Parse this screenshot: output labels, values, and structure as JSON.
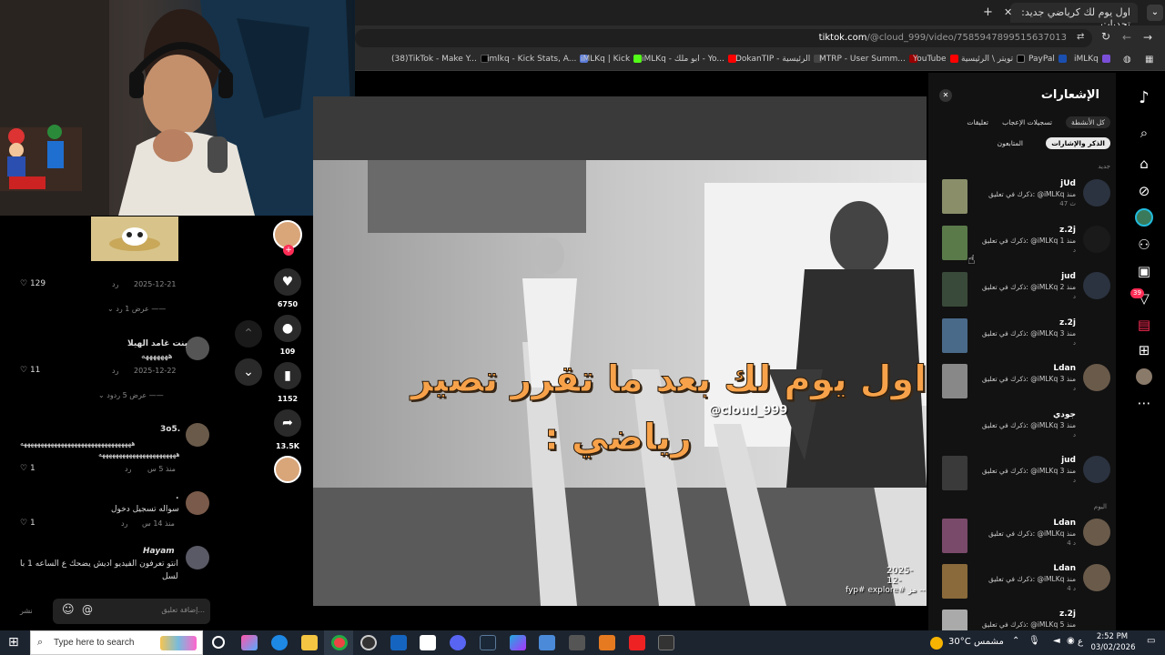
{
  "browser": {
    "tab_title": "اول يوم لك كرياضي جديد: تحديات",
    "url_domain": "tiktok.com",
    "url_path": "/@cloud_999/video/7585947899515637013",
    "bookmarks": [
      "(38)TikTok - Make Y...",
      "imlkq - Kick Stats, A...",
      "iMLKq | Kick",
      "iMLKq - ابو ملك - Yo...",
      "DokanTIP - الرئيسية",
      "MTRP - User Summ...",
      "YouTube",
      "تويتر \\ الرئيسية",
      "PayPal",
      "iMLKq"
    ]
  },
  "comments": {
    "reply_date_1": "2025-12-21",
    "reply_label": "رد",
    "likes_1": "129",
    "view_replies_1": "عرض 1 رد",
    "c1_user": "بنت غامد الهيلا",
    "c1_text": "هههههههه",
    "c1_likes": "11",
    "c1_date": "2025-12-22",
    "view_replies_2": "عرض 5 ردود",
    "c2_user": "3o5.",
    "c2_text_1": "هههههههههههههههههههههههههههههههههه",
    "c2_text_2": "هههههههههههههههههههههههه",
    "c2_likes": "1",
    "c2_time": "منذ 5 س",
    "c3_user": ".",
    "c3_text": "سواله تسجيل دخول",
    "c3_likes": "1",
    "c3_time": "منذ 14 س",
    "c4_user": "Hayam",
    "c4_text_1": "انتو تعرفون الفيديو اديش يضحك ع الساعه 1 با",
    "c4_text_2": "لسل",
    "input_placeholder": "إضافة تعليق...",
    "post_label": "نشر"
  },
  "actions": {
    "likes": "6750",
    "comments": "109",
    "saves": "1152",
    "shares": "13.5K"
  },
  "video": {
    "caption_line1": "اول يوم لك بعد ما تقرر تصير",
    "caption_line2": "رياضي :",
    "watermark": "@cloud_999",
    "date": "2025-12-",
    "tags": "fyp# explore# مز --"
  },
  "notifications": {
    "title": "الإشعارات",
    "tabs": [
      "كل الأنشطة",
      "تسجيلات الإعجاب",
      "تعليقات",
      "الذكر والإشارات",
      "المتابعون"
    ],
    "section_new": "جديد",
    "section_today": "اليوم",
    "items": [
      {
        "name": "jUd",
        "msg": "ذكرك في تعليق: @iMLKq منذ",
        "time": "47 ث"
      },
      {
        "name": "z.2j",
        "msg": "ذكرك في تعليق: @iMLKq منذ 1",
        "time": "د"
      },
      {
        "name": "jud",
        "msg": "ذكرك في تعليق: @iMLKq منذ 2",
        "time": "د"
      },
      {
        "name": "z.2j",
        "msg": "ذكرك في تعليق: @iMLKq منذ 3",
        "time": "د"
      },
      {
        "name": "Ldan",
        "msg": "ذكرك في تعليق: @iMLKq منذ 3",
        "time": "د"
      },
      {
        "name": "جودي",
        "msg": "ذكرك في تعليق: @iMLKq منذ 3",
        "time": "د"
      },
      {
        "name": "jud",
        "msg": "ذكرك في تعليق: @iMLKq منذ 3",
        "time": "د"
      },
      {
        "name": "Ldan",
        "msg": "ذكرك في تعليق: @iMLKq منذ",
        "time": "4 د"
      },
      {
        "name": "Ldan",
        "msg": "ذكرك في تعليق: @iMLKq منذ",
        "time": "4 د"
      },
      {
        "name": "z.2j",
        "msg": "ذكرك في تعليق: @iMLKq منذ 5",
        "time": ""
      }
    ]
  },
  "sidebar": {
    "badge": "39"
  },
  "taskbar": {
    "search_placeholder": "Type here to search",
    "weather": "30°C",
    "weather_desc": "مشمس",
    "time": "2:52 PM",
    "date": "03/02/2026",
    "lang": "ع"
  }
}
